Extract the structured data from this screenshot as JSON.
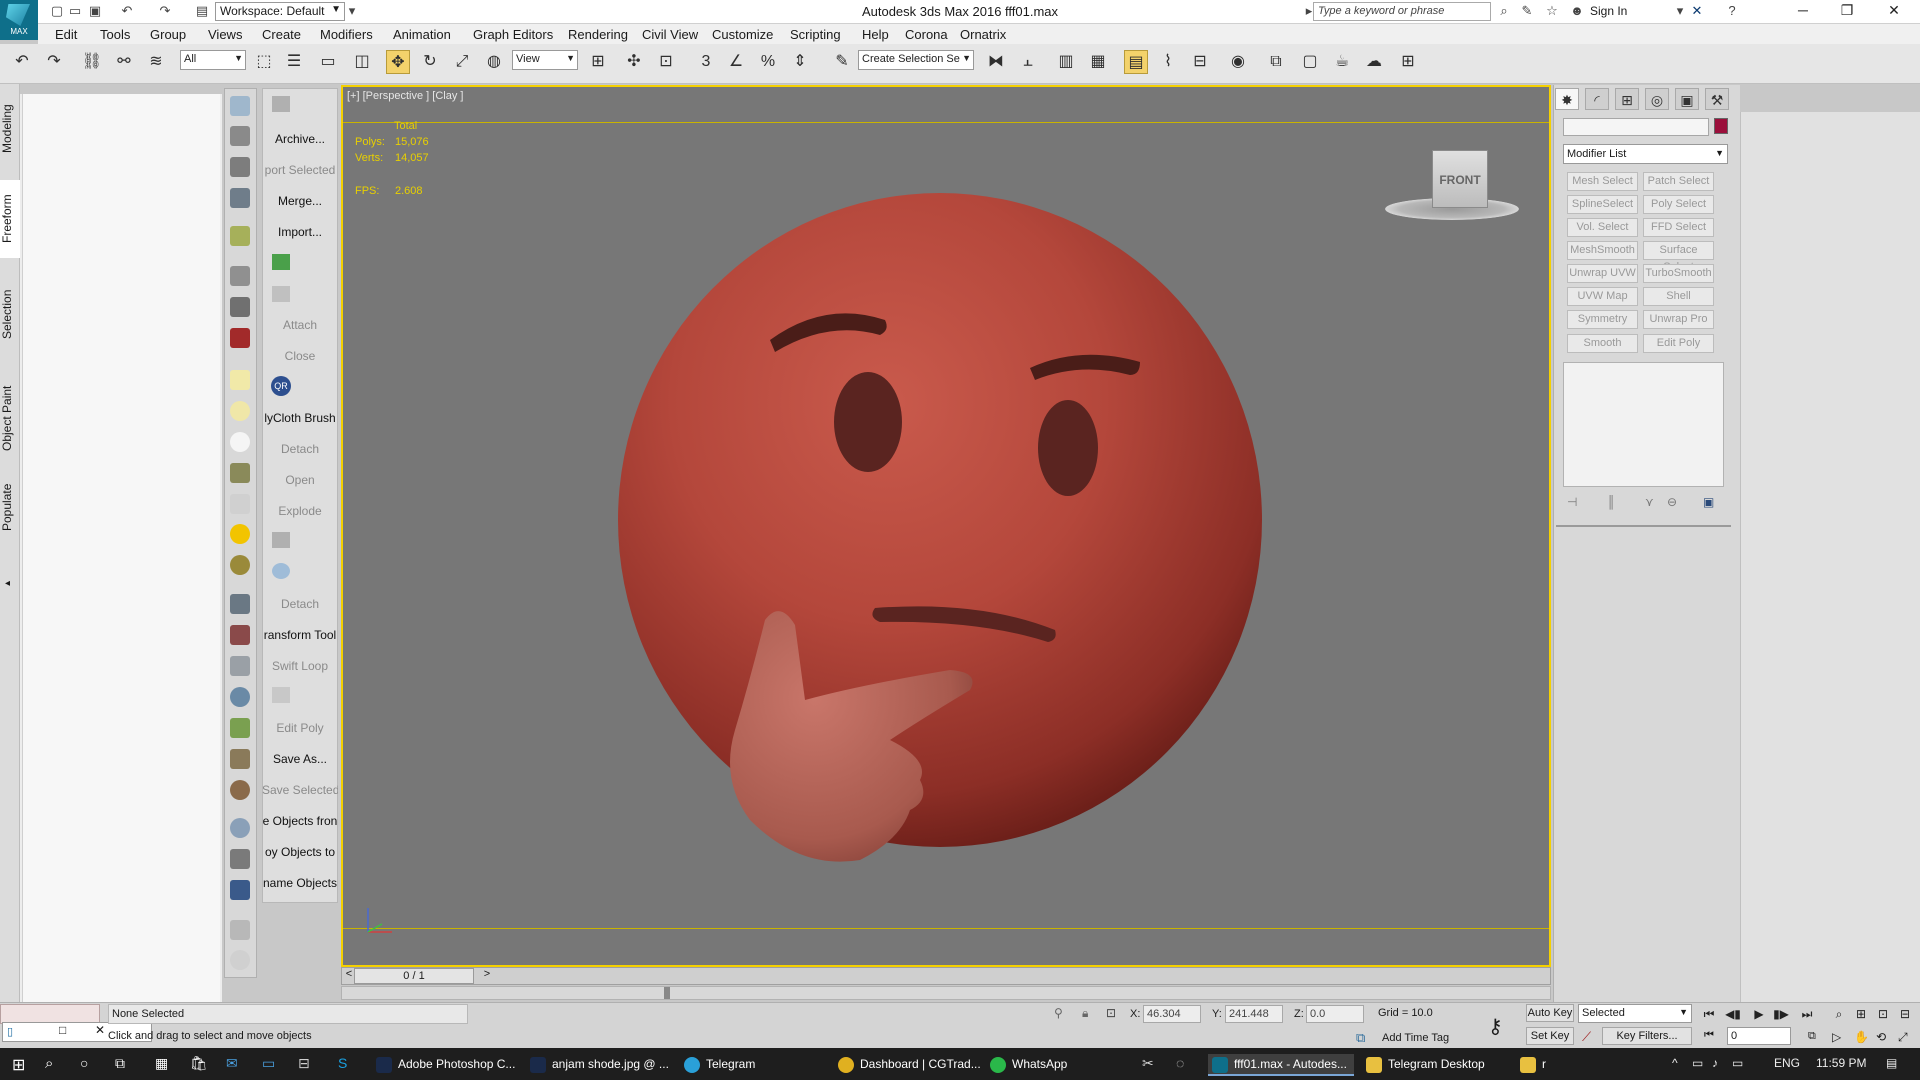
{
  "window": {
    "title": "Autodesk 3ds Max 2016    fff01.max",
    "logo_text": "MAX",
    "workspace": "Workspace: Default",
    "search_placeholder": "Type a keyword or phrase",
    "signin": "Sign In"
  },
  "menu": [
    "Edit",
    "Tools",
    "Group",
    "Views",
    "Create",
    "Modifiers",
    "Animation",
    "Graph Editors",
    "Rendering",
    "Civil View",
    "Customize",
    "Scripting",
    "Help",
    "Corona",
    "Ornatrix"
  ],
  "toolbar": {
    "filter": "All",
    "refcoord": "View",
    "named_selection": "Create Selection Se"
  },
  "ribbon_tabs": [
    "Modeling",
    "Freeform",
    "Selection",
    "Object Paint",
    "Populate"
  ],
  "commands": [
    {
      "label": "Archive...",
      "dim": false
    },
    {
      "label": "port Selected",
      "dim": true
    },
    {
      "label": "Merge...",
      "dim": false
    },
    {
      "label": "Import...",
      "dim": false
    },
    {
      "label": "Attach",
      "dim": true
    },
    {
      "label": "Close",
      "dim": true
    },
    {
      "label": "lyCloth Brush",
      "dim": false
    },
    {
      "label": "Detach",
      "dim": true
    },
    {
      "label": "Open",
      "dim": true
    },
    {
      "label": "Explode",
      "dim": true
    },
    {
      "label": "Detach",
      "dim": true
    },
    {
      "label": "ransform Tool",
      "dim": false
    },
    {
      "label": "Swift Loop",
      "dim": true
    },
    {
      "label": "Edit Poly",
      "dim": true
    },
    {
      "label": "Save As...",
      "dim": false
    },
    {
      "label": "Save Selected",
      "dim": true
    },
    {
      "label": "e Objects fron",
      "dim": false
    },
    {
      "label": "oy Objects to",
      "dim": false
    },
    {
      "label": "name Objects",
      "dim": false
    }
  ],
  "viewport": {
    "label": "[+] [Perspective ] [Clay ]",
    "stats": {
      "total_label": "Total",
      "polys_label": "Polys:",
      "polys": "15,076",
      "verts_label": "Verts:",
      "verts": "14,057",
      "fps_label": "FPS:",
      "fps": "2.608"
    },
    "viewcube": "FRONT"
  },
  "command_panel": {
    "modifier_list": "Modifier List",
    "object_color": "#9b0f3b",
    "modifier_buttons": [
      "Mesh Select",
      "Patch Select",
      "SplineSelect",
      "Poly Select",
      "Vol. Select",
      "FFD Select",
      "MeshSmooth",
      "Surface Select",
      "Unwrap UVW",
      "TurboSmooth",
      "UVW Map",
      "Shell",
      "Symmetry",
      "Unwrap Pro",
      "Smooth",
      "Edit Poly"
    ]
  },
  "timeline": {
    "frame": "0 / 1"
  },
  "status": {
    "selection": "None Selected",
    "prompt": "Click and drag to select and move objects",
    "x_label": "X:",
    "x": "46.304",
    "y_label": "Y:",
    "y": "241.448",
    "z_label": "Z:",
    "z": "0.0",
    "grid": "Grid = 10.0",
    "add_time_tag": "Add Time Tag",
    "auto_key": "Auto Key",
    "set_key": "Set Key",
    "selected": "Selected",
    "key_filters": "Key Filters...",
    "current_frame": "0"
  },
  "taskbar": {
    "apps": [
      "Adobe Photoshop C...",
      "anjam shode.jpg @ ...",
      "Telegram",
      "Dashboard | CGTrad...",
      "WhatsApp",
      "fff01.max - Autodes...",
      "Telegram Desktop",
      "r"
    ],
    "lang": "ENG",
    "time": "11:59 PM"
  }
}
